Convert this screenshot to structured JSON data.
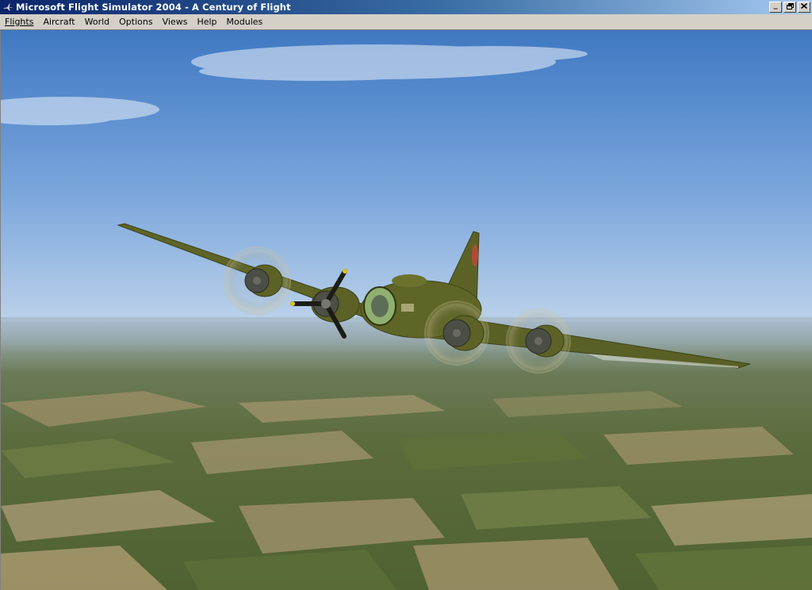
{
  "window": {
    "title": "Microsoft Flight Simulator 2004 - A Century of Flight",
    "controls": {
      "minimize": "_",
      "restore": "❐",
      "close": "✕"
    }
  },
  "menu": {
    "items": [
      {
        "id": "flights",
        "label": "Flights"
      },
      {
        "id": "aircraft",
        "label": "Aircraft"
      },
      {
        "id": "world",
        "label": "World"
      },
      {
        "id": "options",
        "label": "Options"
      },
      {
        "id": "views",
        "label": "Views"
      },
      {
        "id": "help",
        "label": "Help"
      },
      {
        "id": "modules",
        "label": "Modules"
      }
    ]
  },
  "scene": {
    "subject": "b17-bomber-aircraft",
    "colors": {
      "sky_top": "#4a82c8",
      "sky_horizon": "#b9d0ea",
      "haze": "#9fb4c6",
      "field_green": "#4e6a3a",
      "field_tan": "#a39572",
      "aircraft_olive": "#5d6325"
    }
  }
}
